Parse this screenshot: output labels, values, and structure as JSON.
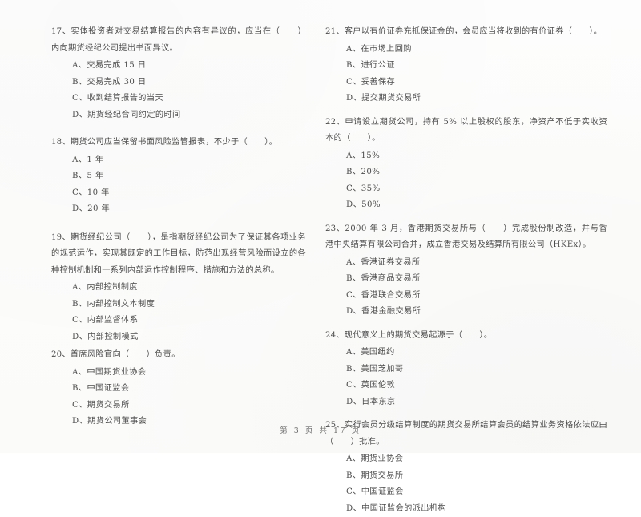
{
  "document": {
    "type": "exam-paper-scan",
    "language": "zh-CN",
    "footer": "第 3 页 共 17 页",
    "ink_color": "#4c4c4c",
    "paper_color": "#fdfdfd"
  },
  "left_column": [
    {
      "number": "17、",
      "stem": "实体投资者对交易结算报告的内容有异议的，应当在（　　）内向期货经纪公司提出书面异议。",
      "options": [
        "A、交易完成 15 日",
        "B、交易完成 30 日",
        "C、收到结算报告的当天",
        "D、期货经纪合同约定的时间"
      ]
    },
    {
      "number": "18、",
      "stem": "期货公司应当保留书面风险监管报表，不少于（　　）。",
      "options": [
        "A、1 年",
        "B、5 年",
        "C、10 年",
        "D、20 年"
      ]
    },
    {
      "number": "19、",
      "stem": "期货经纪公司（　　），是指期货经纪公司为了保证其各项业务的规范运作，实现其既定的工作目标，防范出现经营风险而设立的各种控制机制和一系列内部运作控制程序、措施和方法的总称。",
      "options": [
        "A、内部控制制度",
        "B、内部控制文本制度",
        "C、内部监督体系",
        "D、内部控制模式"
      ]
    },
    {
      "number": "20、",
      "stem": "首席风险官向（　　）负责。",
      "options": [
        "A、中国期货业协会",
        "B、中国证监会",
        "C、期货交易所",
        "D、期货公司董事会"
      ]
    }
  ],
  "right_column": [
    {
      "number": "21、",
      "stem": "客户以有价证券充抵保证金的，会员应当将收到的有价证券（　　）。",
      "options": [
        "A、在市场上回购",
        "B、进行公证",
        "C、妥善保存",
        "D、提交期货交易所"
      ]
    },
    {
      "number": "22、",
      "stem": "申请设立期货公司，持有 5% 以上股权的股东，净资产不低于实收资本的（　　）。",
      "options": [
        "A、15%",
        "B、20%",
        "C、35%",
        "D、50%"
      ]
    },
    {
      "number": "23、",
      "stem": "2000 年 3 月，香港期货交易所与（　　）完成股份制改造，并与香港中央结算有限公司合并，成立香港交易及结算所有限公司（HKEx）。",
      "options": [
        "A、香港证券交易所",
        "B、香港商品交易所",
        "C、香港联合交易所",
        "D、香港金融交易所"
      ]
    },
    {
      "number": "24、",
      "stem": "现代意义上的期货交易起源于（　　）。",
      "options": [
        "A、美国纽约",
        "B、美国芝加哥",
        "C、英国伦敦",
        "D、日本东京"
      ]
    },
    {
      "number": "25、",
      "stem": "实行会员分级结算制度的期货交易所结算会员的结算业务资格依法应由（　　）批准。",
      "options": [
        "A、期货业协会",
        "B、期货交易所",
        "C、中国证监会",
        "D、中国证监会的派出机构"
      ]
    }
  ]
}
